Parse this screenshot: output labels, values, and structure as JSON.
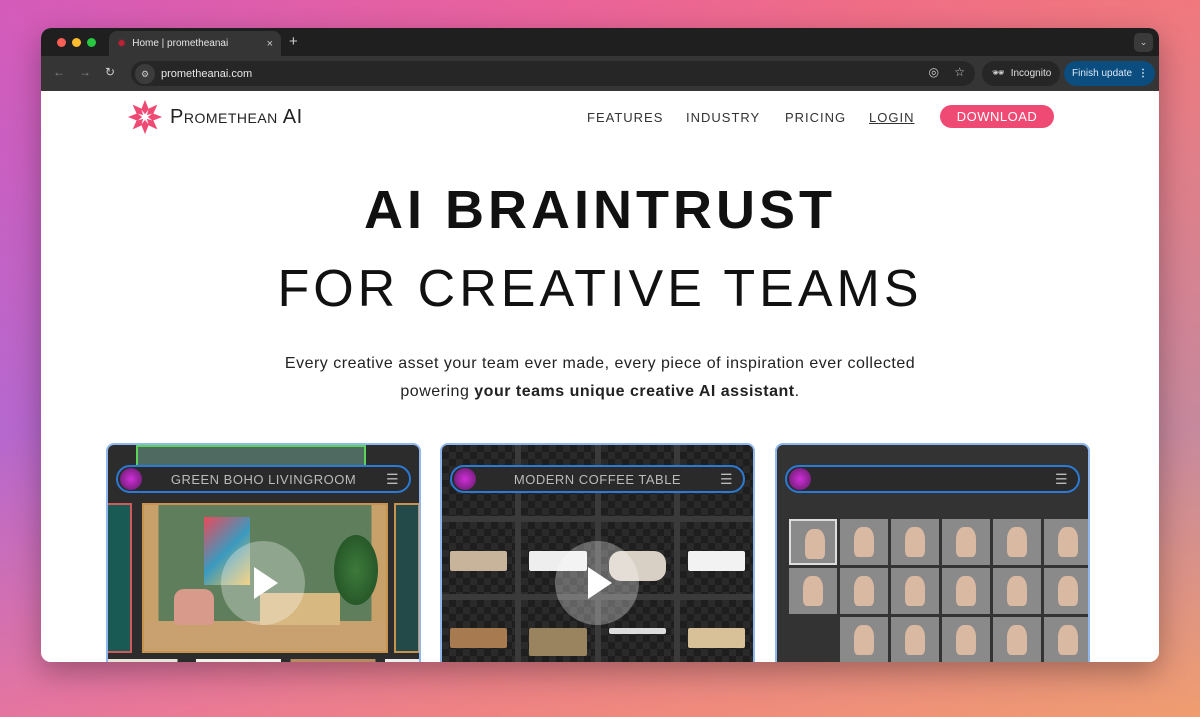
{
  "browser": {
    "tab_title": "Home | prometheanai",
    "tab_close": "×",
    "new_tab": "+",
    "url": "prometheanai.com",
    "incognito_label": "Incognito",
    "finish_update_label": "Finish update"
  },
  "site": {
    "brand": "Promethean AI",
    "brand_color": "#ef4a74",
    "nav": [
      "FEATURES",
      "INDUSTRY",
      "PRICING",
      "LOGIN"
    ],
    "download_label": "DOWNLOAD"
  },
  "hero": {
    "title_line1": "AI BRAINTRUST",
    "title_line2": "FOR CREATIVE TEAMS",
    "subtitle_line1": "Every creative asset your team ever made, every piece of inspiration ever collected",
    "subtitle_prefix": "powering ",
    "subtitle_bold": "your teams unique creative AI assistant",
    "subtitle_suffix": "."
  },
  "cards": [
    {
      "title": "GREEN BOHO LIVINGROOM"
    },
    {
      "title": "MODERN COFFEE TABLE"
    },
    {
      "title": ""
    }
  ]
}
